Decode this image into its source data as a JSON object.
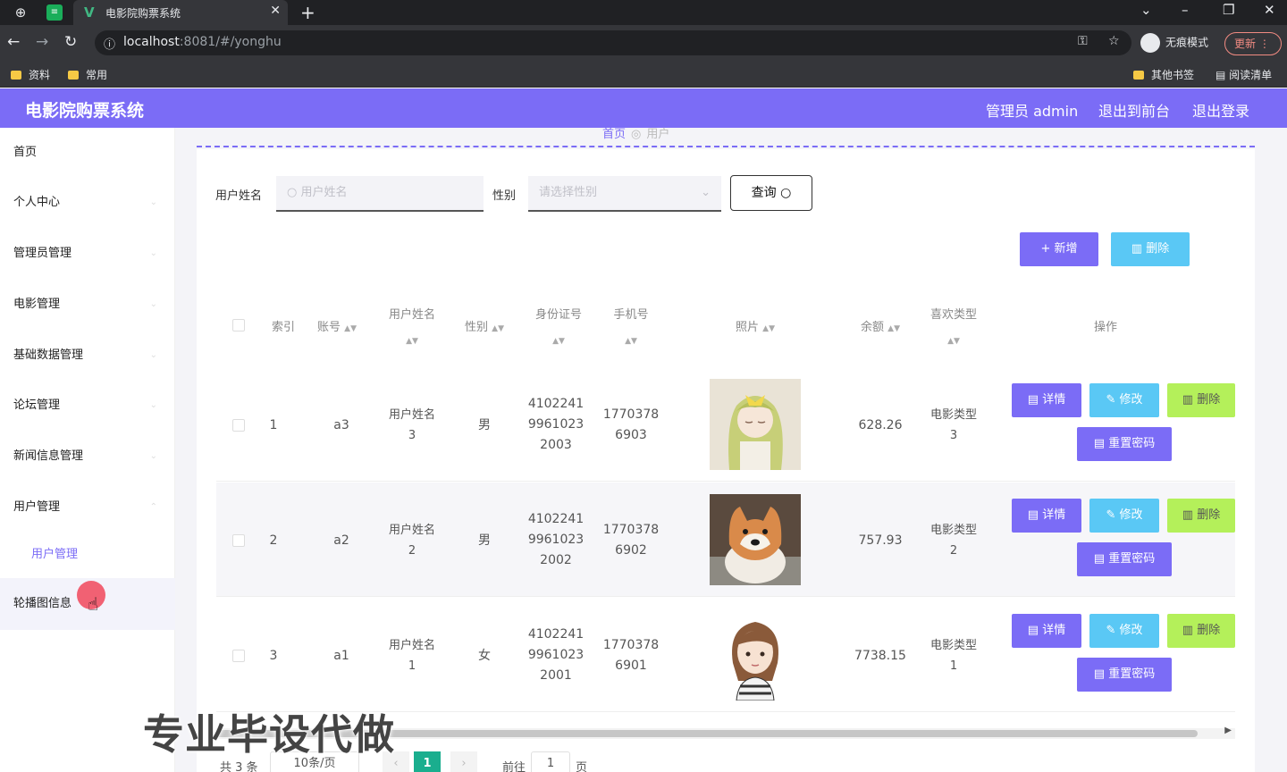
{
  "browser": {
    "tab_title": "电影院购票系统",
    "url_host": "localhost",
    "url_rest": ":8081/#/yonghu",
    "incognito_label": "无痕模式",
    "update_label": "更新",
    "bookmarks": [
      "资料",
      "常用"
    ],
    "bookmarks_right": [
      "其他书签",
      "阅读清单"
    ]
  },
  "header": {
    "title": "电影院购票系统",
    "admin_label": "管理员 admin",
    "back_to_front": "退出到前台",
    "logout": "退出登录"
  },
  "sidebar": {
    "items": [
      "首页",
      "个人中心",
      "管理员管理",
      "电影管理",
      "基础数据管理",
      "论坛管理",
      "新闻信息管理",
      "用户管理"
    ],
    "sub_item": "用户管理",
    "last_item": "轮播图信息"
  },
  "breadcrumb": {
    "home": "首页",
    "current": "用户"
  },
  "search": {
    "name_label": "用户姓名",
    "name_placeholder": "用户姓名",
    "gender_label": "性别",
    "gender_placeholder": "请选择性别",
    "query_label": "查询"
  },
  "actions": {
    "add_label": "+ 新增",
    "delete_label": "删除"
  },
  "table": {
    "headers": {
      "index": "索引",
      "account": "账号",
      "name": "用户姓名",
      "gender": "性别",
      "id_card": "身份证号",
      "phone": "手机号",
      "photo": "照片",
      "balance": "余额",
      "fav_type": "喜欢类型",
      "ops": "操作"
    },
    "rows": [
      {
        "index": "1",
        "account": "a3",
        "name1": "用户姓名",
        "name2": "3",
        "gender": "男",
        "id1": "4102241",
        "id2": "9961023",
        "id3": "2003",
        "ph1": "1770378",
        "ph2": "6903",
        "balance": "628.26",
        "type1": "电影类型",
        "type2": "3"
      },
      {
        "index": "2",
        "account": "a2",
        "name1": "用户姓名",
        "name2": "2",
        "gender": "男",
        "id1": "4102241",
        "id2": "9961023",
        "id3": "2002",
        "ph1": "1770378",
        "ph2": "6902",
        "balance": "757.93",
        "type1": "电影类型",
        "type2": "2"
      },
      {
        "index": "3",
        "account": "a1",
        "name1": "用户姓名",
        "name2": "1",
        "gender": "女",
        "id1": "4102241",
        "id2": "9961023",
        "id3": "2001",
        "ph1": "1770378",
        "ph2": "6901",
        "balance": "7738.15",
        "type1": "电影类型",
        "type2": "1"
      }
    ],
    "btn_detail": "详情",
    "btn_edit": "修改",
    "btn_delete": "删除",
    "btn_reset": "重置密码"
  },
  "pagination": {
    "total_text": "共 3 条",
    "page_size": "10条/页",
    "current": "1",
    "goto_label": "前往",
    "goto_value": "1",
    "page_unit": "页"
  },
  "watermark": "专业毕设代做"
}
